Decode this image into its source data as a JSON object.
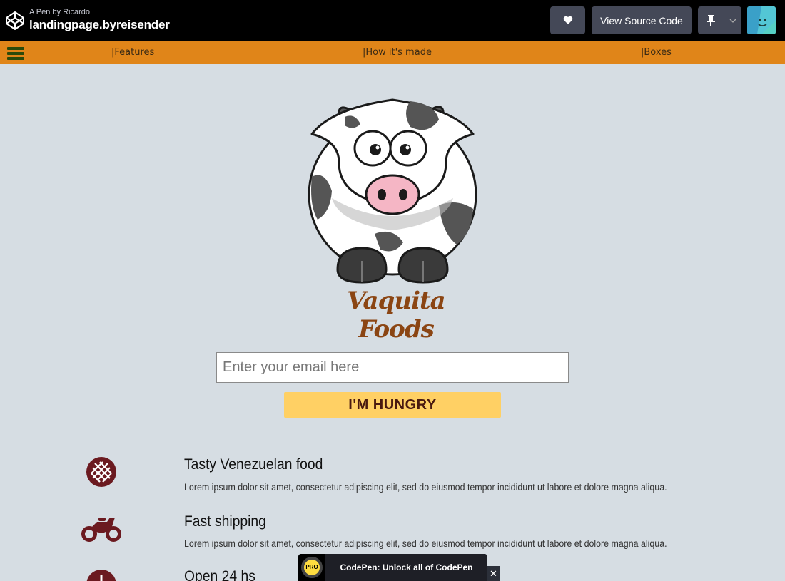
{
  "header": {
    "byline": "A Pen by Ricardo",
    "title": "landingpage.byreisender",
    "heart_icon": "heart-icon",
    "view_source_label": "View Source Code",
    "pin_icon": "pin-icon",
    "dropdown_icon": "chevron-down-icon"
  },
  "nav": {
    "links": [
      {
        "label": "|Features"
      },
      {
        "label": "|How it's made"
      },
      {
        "label": "|Boxes"
      }
    ],
    "color": "#e08519"
  },
  "hero": {
    "brand": "Vaquita Foods",
    "email_placeholder": "Enter your email here",
    "cta_label": "I'M HUNGRY"
  },
  "features": [
    {
      "icon": "waffle-icon",
      "title": "Tasty Venezuelan food",
      "desc": "Lorem ipsum dolor sit amet, consectetur adipiscing elit, sed do eiusmod tempor incididunt ut labore et dolore magna aliqua."
    },
    {
      "icon": "motorcycle-icon",
      "title": "Fast shipping",
      "desc": "Lorem ipsum dolor sit amet, consectetur adipiscing elit, sed do eiusmod tempor incididunt ut labore et dolore magna aliqua."
    },
    {
      "icon": "clock-icon",
      "title": "Open 24 hs"
    }
  ],
  "pro_banner": {
    "badge": "PRO",
    "text": "CodePen: Unlock all of CodePen",
    "close": "✕"
  },
  "colors": {
    "background": "#d6dde3",
    "accent": "#ffd064",
    "icon": "#6b1a20"
  }
}
